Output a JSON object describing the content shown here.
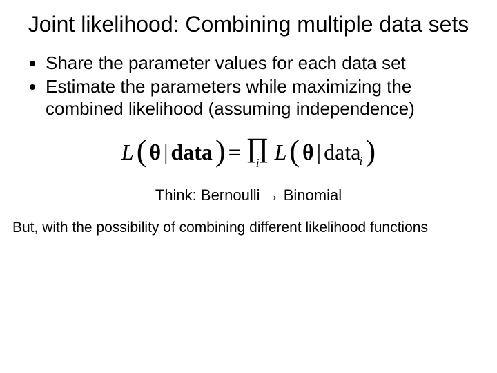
{
  "title": "Joint likelihood: Combining multiple data sets",
  "bullets": [
    "Share the parameter values for each data set",
    "Estimate the parameters while maximizing the combined likelihood (assuming independence)"
  ],
  "equation": {
    "L1": "L",
    "lparen": "(",
    "theta": "θ",
    "bar": " | ",
    "data": "data",
    "rparen": ")",
    "eq": "=",
    "prod_sym": "∏",
    "prod_idx": "i",
    "L2": "L",
    "sub_i": "i"
  },
  "caption": "Think: Bernoulli → Binomial",
  "footer": "But, with the possibility of combining different likelihood functions"
}
